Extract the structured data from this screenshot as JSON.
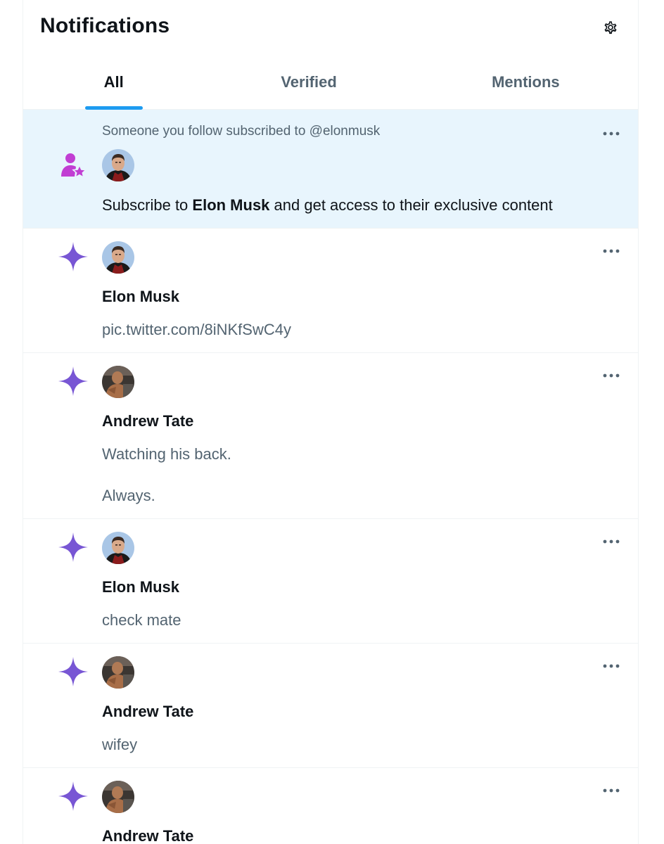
{
  "header": {
    "title": "Notifications",
    "settings_icon": "gear-icon"
  },
  "tabs": [
    {
      "label": "All",
      "active": true
    },
    {
      "label": "Verified",
      "active": false
    },
    {
      "label": "Mentions",
      "active": false
    }
  ],
  "colors": {
    "accent": "#1d9bf0",
    "highlight_bg": "#e8f5fd",
    "sparkle": "#7856d4",
    "subscribe_icon": "#c13ed3",
    "secondary_text": "#536471",
    "primary_text": "#0f1419"
  },
  "subscription_notice": {
    "icon": "person-star-icon",
    "note": "Someone you follow subscribed to @elonmusk",
    "avatar": "elon-musk-avatar",
    "text_before": "Subscribe to ",
    "name": "Elon Musk",
    "text_after": " and get access to their exclusive content"
  },
  "notifications": [
    {
      "icon": "sparkle-icon",
      "avatar": "elon-musk-avatar",
      "author": "Elon Musk",
      "lines": [
        "pic.twitter.com/8iNKfSwC4y"
      ]
    },
    {
      "icon": "sparkle-icon",
      "avatar": "andrew-tate-avatar",
      "author": "Andrew Tate",
      "lines": [
        "Watching his back.",
        "Always."
      ]
    },
    {
      "icon": "sparkle-icon",
      "avatar": "elon-musk-avatar",
      "author": "Elon Musk",
      "lines": [
        "check mate"
      ]
    },
    {
      "icon": "sparkle-icon",
      "avatar": "andrew-tate-avatar",
      "author": "Andrew Tate",
      "lines": [
        "wifey"
      ]
    },
    {
      "icon": "sparkle-icon",
      "avatar": "andrew-tate-avatar",
      "author": "Andrew Tate",
      "lines": []
    }
  ]
}
